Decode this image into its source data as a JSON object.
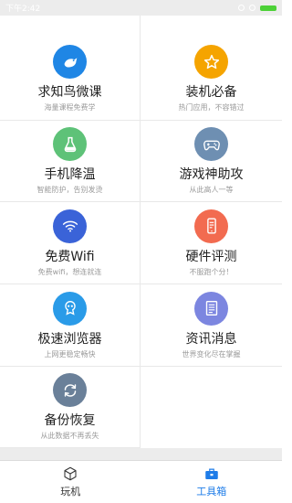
{
  "status_bar": {
    "time": "下午2:42"
  },
  "tools": [
    {
      "title": "求知鸟微课",
      "subtitle": "海量课程免费学",
      "icon": "bird-icon",
      "color": "#1f86e5"
    },
    {
      "title": "装机必备",
      "subtitle": "热门应用，不容错过",
      "icon": "star-icon",
      "color": "#f5a400"
    },
    {
      "title": "手机降温",
      "subtitle": "智能防护，告别发烫",
      "icon": "flask-icon",
      "color": "#5ec278"
    },
    {
      "title": "游戏神助攻",
      "subtitle": "从此高人一等",
      "icon": "gamepad-icon",
      "color": "#6e8fb2"
    },
    {
      "title": "免费Wifi",
      "subtitle": "免费wifi，想连就连",
      "icon": "wifi-icon",
      "color": "#3a63d8"
    },
    {
      "title": "硬件评测",
      "subtitle": "不服跑个分！",
      "icon": "phone-icon",
      "color": "#f26b50"
    },
    {
      "title": "极速浏览器",
      "subtitle": "上网更稳定畅快",
      "icon": "browser-icon",
      "color": "#2a9be8"
    },
    {
      "title": "资讯消息",
      "subtitle": "世界变化尽在掌握",
      "icon": "news-icon",
      "color": "#7c86e0"
    },
    {
      "title": "备份恢复",
      "subtitle": "从此数据不再丢失",
      "icon": "sync-icon",
      "color": "#6a8099"
    }
  ],
  "tabs": [
    {
      "label": "玩机",
      "icon": "box-icon",
      "active": false
    },
    {
      "label": "工具箱",
      "icon": "toolbox-icon",
      "active": true
    }
  ],
  "colors": {
    "tab_active": "#1e7ce8",
    "divider": "#e8e8e8",
    "background_gray": "#ececec"
  }
}
